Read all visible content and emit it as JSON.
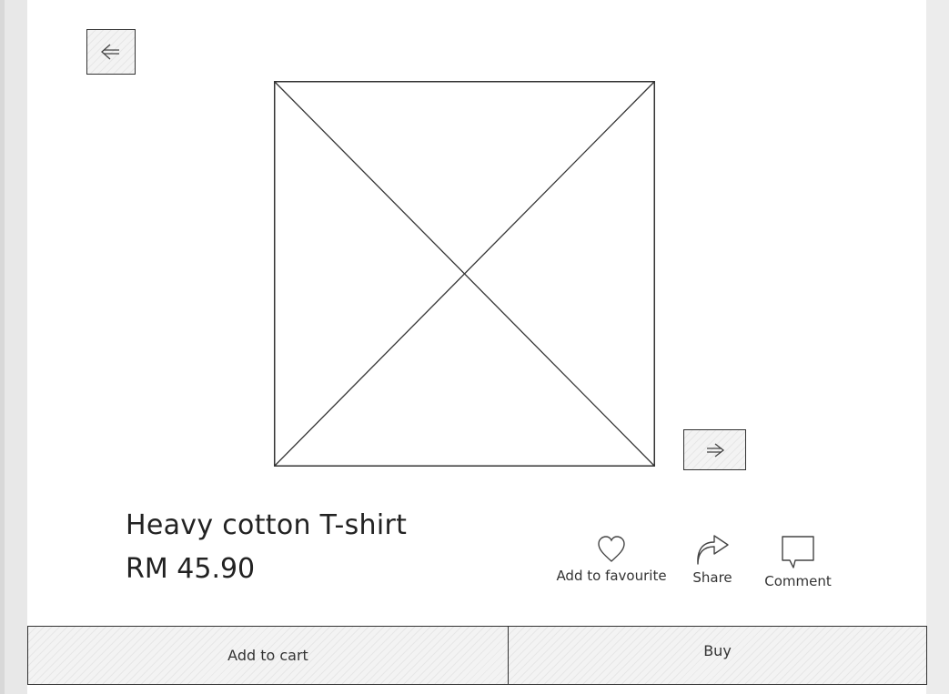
{
  "product": {
    "title": "Heavy cotton T-shirt",
    "price": "RM 45.90"
  },
  "actions": {
    "favourite_label": "Add to favourite",
    "share_label": "Share",
    "comment_label": "Comment"
  },
  "buttons": {
    "add_to_cart_label": "Add to cart",
    "buy_label": "Buy"
  },
  "icons": {
    "prev": "arrow-left-icon",
    "next": "arrow-right-icon",
    "favourite": "heart-icon",
    "share": "share-icon",
    "comment": "comment-icon",
    "image": "image-placeholder-icon"
  },
  "colors": {
    "background": "#ffffff",
    "stroke": "#333333",
    "fill": "#f3f3f3"
  }
}
